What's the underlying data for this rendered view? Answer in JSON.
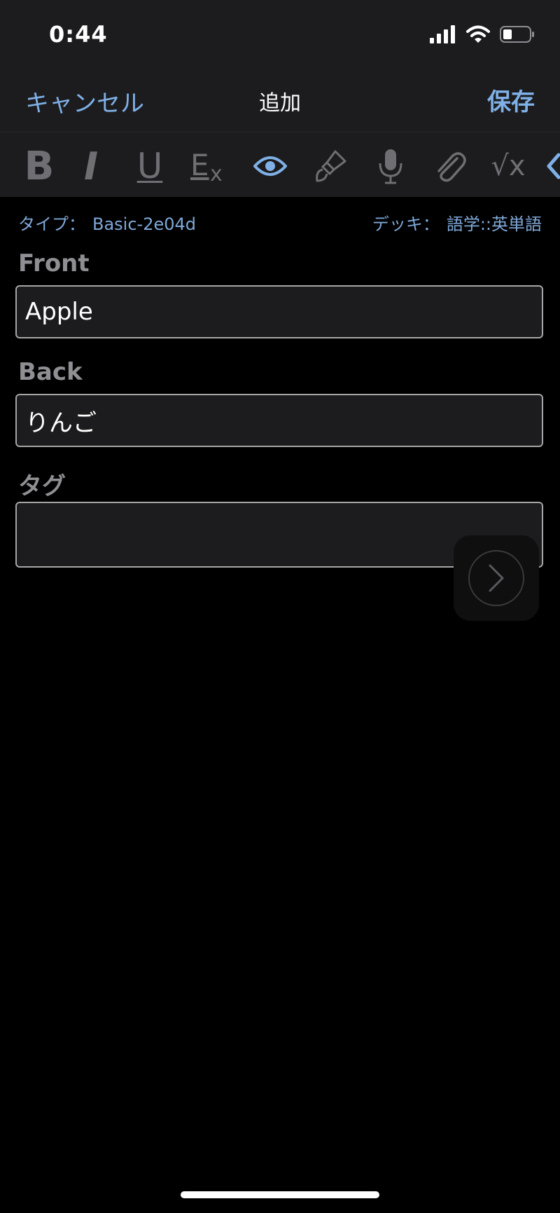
{
  "status": {
    "time": "0:44"
  },
  "nav": {
    "cancel_label": "キャンセル",
    "title": "追加",
    "save_label": "保存"
  },
  "toolbar": {
    "bold_label": "B",
    "italic_label": "I",
    "underline_label": "U",
    "clear_format_label": "E",
    "clear_format_sub": "x",
    "formula_label": "√x",
    "icons": [
      "bold",
      "italic",
      "underline",
      "clear-format-icon",
      "eye-icon",
      "brush-icon",
      "microphone-icon",
      "paperclip-icon",
      "formula-icon",
      "code-icon"
    ]
  },
  "meta": {
    "type_label": "タイプ：",
    "type_value": "Basic-2e04d",
    "deck_label": "デッキ：",
    "deck_value": "語学::英単語"
  },
  "fields": [
    {
      "label": "Front",
      "value": "Apple"
    },
    {
      "label": "Back",
      "value": "りんご"
    },
    {
      "label": "タグ",
      "value": ""
    }
  ],
  "colors": {
    "accent": "#7fb0e6",
    "background": "#000000",
    "bar": "#1c1c1e",
    "muted": "#8e8e93"
  }
}
